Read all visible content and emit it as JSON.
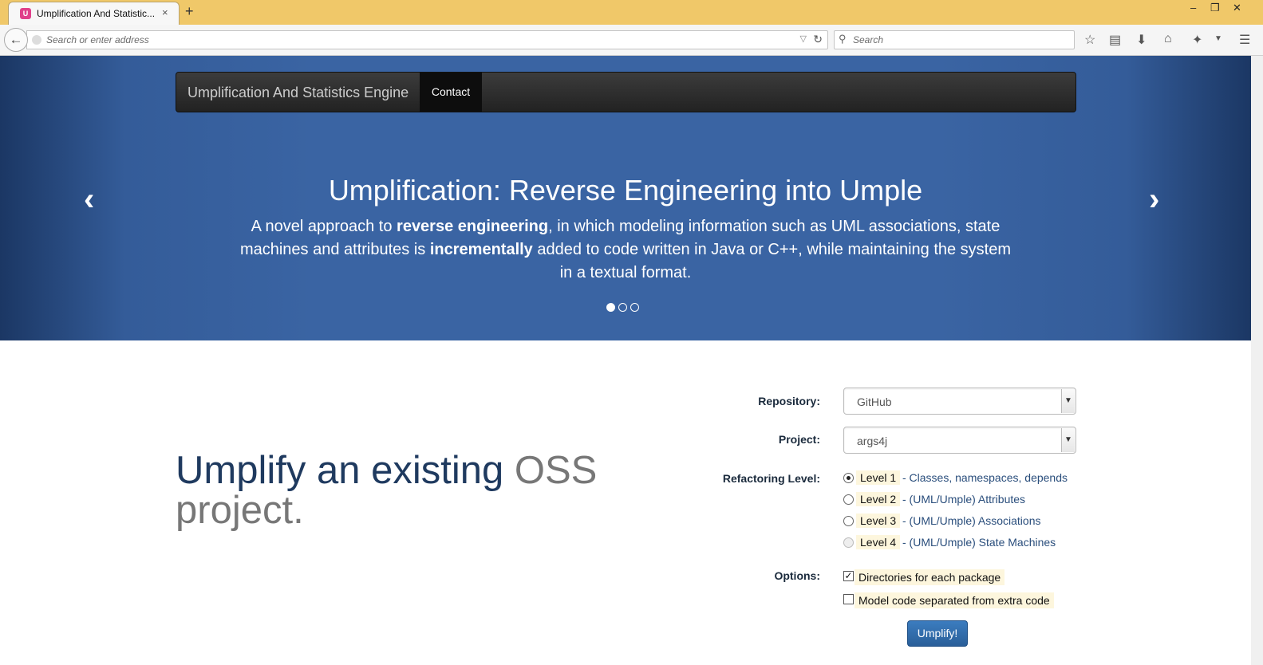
{
  "browser": {
    "tab_title": "Umplification And Statistic...",
    "tab_close": "×",
    "new_tab": "+",
    "url_placeholder": "Search or enter address",
    "search_placeholder": "Search",
    "favicon_letter": "U"
  },
  "site": {
    "brand": "Umplification And Statistics Engine",
    "nav_contact": "Contact"
  },
  "carousel": {
    "title": "Umplification: Reverse Engineering into Umple",
    "text_parts": {
      "p1": "A novel approach to ",
      "b1": "reverse engineering",
      "p2": ", in which modeling information such as UML associations, state machines and attributes is ",
      "b2": "incrementally",
      "p3": " added to code written in Java or C++, while maintaining the system in a textual format."
    },
    "prev": "‹",
    "next": "›",
    "slide_count": 3,
    "active_slide": 1
  },
  "main": {
    "headline_part1": "Umplify an existing ",
    "headline_part2": "OSS project."
  },
  "form": {
    "repository_label": "Repository:",
    "repository_value": "GitHub",
    "project_label": "Project:",
    "project_value": "args4j",
    "refactoring_label": "Refactoring Level:",
    "levels": [
      {
        "tag": "Level 1",
        "desc": "- Classes, namespaces, depends",
        "checked": true
      },
      {
        "tag": "Level 2",
        "desc": "- (UML/Umple) Attributes",
        "checked": false
      },
      {
        "tag": "Level 3",
        "desc": "- (UML/Umple) Associations",
        "checked": false
      },
      {
        "tag": "Level 4",
        "desc": "- (UML/Umple) State Machines",
        "checked": false
      }
    ],
    "options_label": "Options:",
    "options": [
      {
        "label": "Directories for each package",
        "checked": true
      },
      {
        "label": "Model code separated from extra code",
        "checked": false
      }
    ],
    "submit_label": "Umplify!"
  },
  "colors": {
    "titlebar": "#f0c869",
    "carousel_blue": "#3a64a3",
    "headline_blue": "#1f3a5f",
    "button_blue": "#2a5f99"
  }
}
